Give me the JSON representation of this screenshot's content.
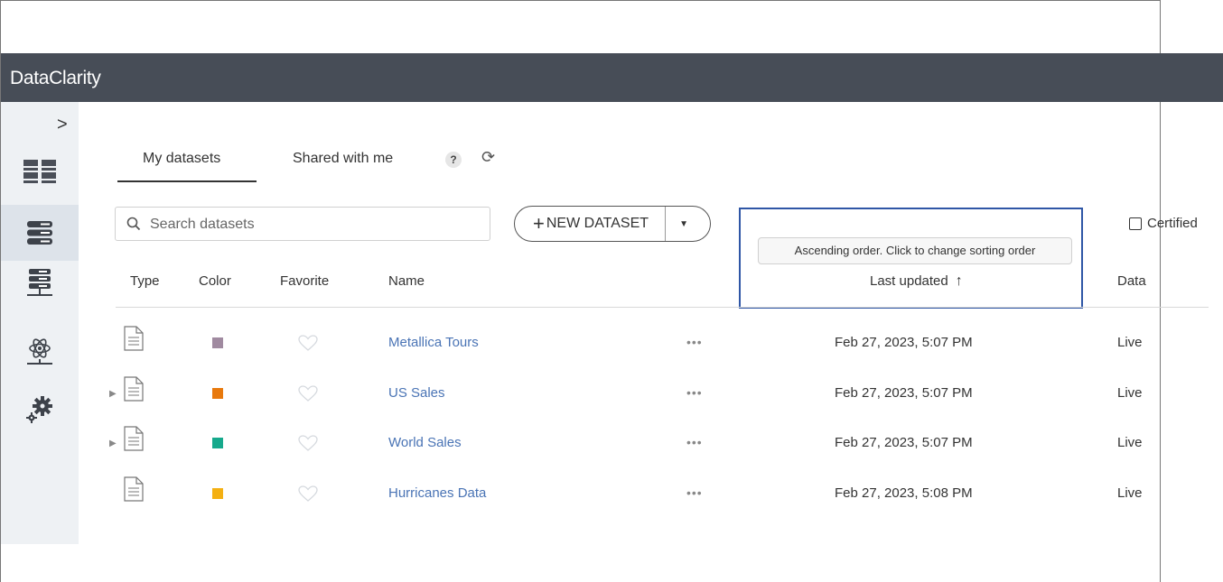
{
  "app": {
    "title": "DataClarity"
  },
  "sidebar": {
    "expand_label": ">",
    "items": [
      {
        "icon": "dashboard-grid-icon"
      },
      {
        "icon": "datasets-stack-icon",
        "active": true
      },
      {
        "icon": "data-sources-icon"
      },
      {
        "icon": "model-atom-icon"
      },
      {
        "icon": "settings-gears-icon"
      }
    ]
  },
  "tabs": [
    {
      "label": "My datasets",
      "active": true
    },
    {
      "label": "Shared with me"
    }
  ],
  "help": {
    "label": "?"
  },
  "refresh": {
    "glyph": "⟳"
  },
  "search": {
    "placeholder": "Search datasets",
    "value": ""
  },
  "new_dataset": {
    "plus": "+",
    "label": "NEW DATASET",
    "dropdown": "▼"
  },
  "certified": {
    "label": "Certified",
    "checked": false
  },
  "tooltip": {
    "text": "Ascending order. Click to change sorting order"
  },
  "columns": {
    "type": "Type",
    "color": "Color",
    "favorite": "Favorite",
    "name": "Name",
    "last_updated": "Last updated",
    "sort_arrow": "↑",
    "data": "Data"
  },
  "rows": [
    {
      "expandable": false,
      "caret": "",
      "color": "#a08aa0",
      "name": "Metallica Tours",
      "more": "•••",
      "updated": "Feb 27, 2023, 5:07 PM",
      "data": "Live"
    },
    {
      "expandable": true,
      "caret": "▶",
      "color": "#e8790d",
      "name": "US Sales",
      "more": "•••",
      "updated": "Feb 27, 2023, 5:07 PM",
      "data": "Live"
    },
    {
      "expandable": true,
      "caret": "▶",
      "color": "#16a98c",
      "name": "World Sales",
      "more": "•••",
      "updated": "Feb 27, 2023, 5:07 PM",
      "data": "Live"
    },
    {
      "expandable": false,
      "caret": "",
      "color": "#f4b012",
      "name": "Hurricanes Data",
      "more": "•••",
      "updated": "Feb 27, 2023, 5:08 PM",
      "data": "Live"
    }
  ]
}
